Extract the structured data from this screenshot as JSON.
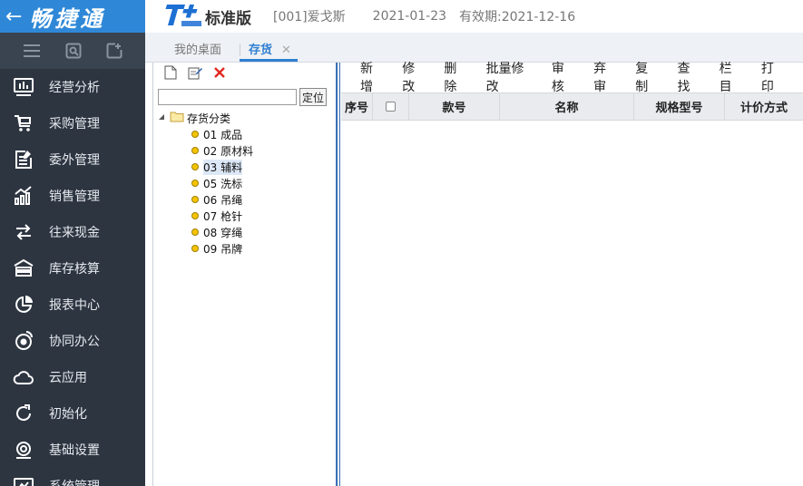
{
  "sidebar": {
    "brand": "畅捷通",
    "back_icon": "←",
    "tool_icons": [
      "menu-icon",
      "search-doc-icon",
      "add-doc-icon"
    ],
    "items": [
      {
        "label": "经营分析",
        "icon": "analysis-icon"
      },
      {
        "label": "采购管理",
        "icon": "cart-icon"
      },
      {
        "label": "委外管理",
        "icon": "outsource-icon"
      },
      {
        "label": "销售管理",
        "icon": "sales-chart-icon"
      },
      {
        "label": "往来现金",
        "icon": "exchange-icon"
      },
      {
        "label": "库存核算",
        "icon": "warehouse-icon"
      },
      {
        "label": "报表中心",
        "icon": "report-pie-icon"
      },
      {
        "label": "协同办公",
        "icon": "collaboration-icon"
      },
      {
        "label": "云应用",
        "icon": "cloud-icon"
      },
      {
        "label": "初始化",
        "icon": "refresh-icon"
      },
      {
        "label": "基础设置",
        "icon": "settings-icon"
      },
      {
        "label": "系统管理",
        "icon": "system-icon"
      }
    ]
  },
  "topbar": {
    "edition": "标准版",
    "account": "[001]爱戈斯",
    "date": "2021-01-23",
    "validity": "有效期:2021-12-16"
  },
  "tabs": {
    "desk": "我的桌面",
    "stock": "存货",
    "close": "✕"
  },
  "leftpanel": {
    "locate_label": "定位",
    "search_value": "",
    "root_label": "存货分类",
    "nodes": [
      "01 成品",
      "02 原材料",
      "03 辅料",
      "05 洗标",
      "06 吊绳",
      "07 枪针",
      "08 穿绳",
      "09 吊牌"
    ],
    "selected_index": 2
  },
  "toolbar": [
    "新增",
    "修改",
    "删除",
    "批量修改",
    "审核",
    "弃审",
    "复制",
    "查找",
    "栏目",
    "打印"
  ],
  "grid": {
    "columns": [
      "序号",
      "",
      "款号",
      "名称",
      "规格型号",
      "计价方式"
    ]
  },
  "colors": {
    "sidebar_bg": "#2d3541",
    "brand_bg": "#2f88d7",
    "accent": "#2f7fd1"
  }
}
